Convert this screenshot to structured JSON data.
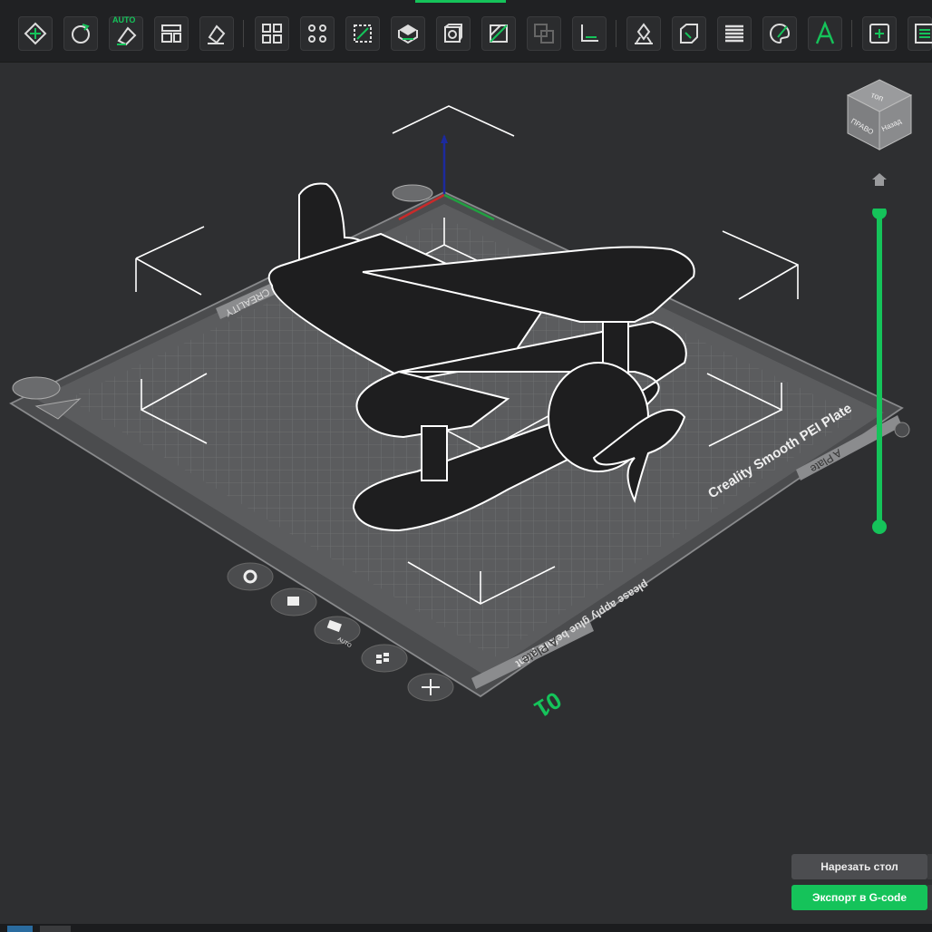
{
  "toolbar": {
    "auto_label": "AUTO",
    "tools": [
      "move-icon",
      "rotate-icon",
      "auto-orient-icon",
      "arrange-icon",
      "lay-on-face-icon",
      "split-objects-icon",
      "split-parts-icon",
      "cut-icon",
      "support-paint-icon",
      "hollow-icon",
      "seam-paint-icon",
      "boolean-icon",
      "measure-icon",
      "support-icon",
      "scale-icon",
      "variable-layer-icon",
      "color-paint-icon",
      "text-icon",
      "assembly-icon",
      "calibrate-icon"
    ]
  },
  "viewcube": {
    "top": "топ",
    "right": "ПРАВО",
    "back": "Назад"
  },
  "plate": {
    "brand": "CREALITY",
    "name": "Creality Smooth PEI Plate",
    "warning": "please apply glue before print",
    "label_right": "A Plate",
    "label_front": "A Plate",
    "number": "01"
  },
  "actions": {
    "slice_label": "Нарезать стол",
    "export_label": "Экспорт в G-code"
  },
  "plate_buttons": [
    "settings-icon",
    "lock-icon",
    "auto-arrange-icon",
    "layout-icon",
    "add-plate-icon"
  ],
  "plate_buttons_auto": "AUTO",
  "colors": {
    "accent": "#15c35a",
    "background": "#2e2f31",
    "toolbar": "#202123",
    "plate": "#5b5c5e",
    "model": "#1e1e1f"
  }
}
